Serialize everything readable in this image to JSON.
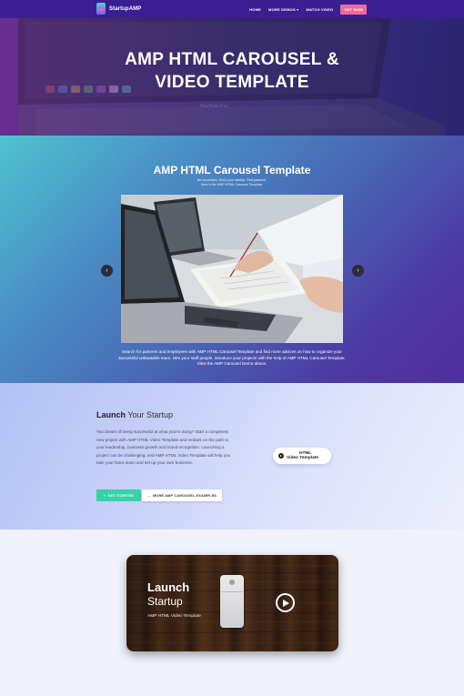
{
  "nav": {
    "brand": "StartupAMP",
    "items": [
      "HOME",
      "MORE DEMOS ▾",
      "WATCH VIDEO"
    ],
    "cta": "GET NOW"
  },
  "hero": {
    "title_line1": "AMP HTML CAROUSEL &",
    "title_line2": "VIDEO TEMPLATE"
  },
  "carousel": {
    "title": "AMP HTML Carousel Template",
    "subtitle_line1": "Be successful. Build your startup. Find partners.",
    "subtitle_line2": "Here is the AMP HTML Carousel Template.",
    "prev_icon": "‹",
    "next_icon": "›",
    "description_line1": "Search for partners and employees with AMP HTML Carousel Template and find more advices on how to organize your",
    "description_line2": "successful unbeatable team. Hire your staff people, introduce your projects with the help of AMP HTML Carousel Template.",
    "description_line3": "View the AMP Carousel Demo above."
  },
  "launch": {
    "heading_bold": "Launch",
    "heading_rest": " Your Startup",
    "text": "You dream of being successful at what you're doing? Start a completely new project with AMP HTML Video Template and embark on the path to your leadership, business growth and brand recognition. Launching a project can be challenging, and AMP HTML Video Template will help you take your fears down and set up your own business.",
    "btn_start": "GET STARTED",
    "btn_start_icon": "⚡",
    "btn_more": "MORE AMP CAROUSEL EXAMPLES",
    "btn_more_icon": "→",
    "pill_line1": "HTML",
    "pill_line2": "Video Template"
  },
  "video": {
    "title_bold": "Launch",
    "title_light": "Startup",
    "subtitle": "AMP HTML Video Template"
  }
}
